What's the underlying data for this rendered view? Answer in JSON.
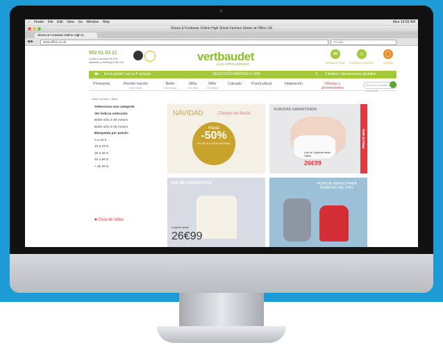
{
  "mac_menubar": {
    "items": [
      "Finder",
      "File",
      "Edit",
      "View",
      "Go",
      "Window",
      "Help"
    ],
    "clock": "Mon 14:55 AM"
  },
  "browser": {
    "window_title": "Shoes & Footwear Online High Street Fashion Shoes at Office UK",
    "tab_label": "Shoes & Footwear Online High S...",
    "url": "www.office.co.uk",
    "search_placeholder": "Google"
  },
  "header": {
    "phone": "902 01 03 21",
    "phone_sub": "Lunes a viernes 9h-22h, sábados y domingos 9h-21h",
    "logo": "vertbaudet",
    "tagline": "¡Los niños primero!",
    "icons": [
      {
        "label": "NEWSLETTER",
        "icon": "mail-icon"
      },
      {
        "label": "ESPACIO CLIENTE",
        "icon": "user-icon"
      },
      {
        "label": "CESTA",
        "icon": "basket-icon"
      }
    ]
  },
  "promo_bar": {
    "left": "Envío gratis* con tu 4º artículo",
    "center": "SELECCIÓN NAVIDAD A -50%",
    "right": "Cambios / devoluciones gratuitas"
  },
  "nav": {
    "items": [
      {
        "label": "Premamá",
        "sub": ""
      },
      {
        "label": "Recién nacido",
        "sub": "0/18 meses"
      },
      {
        "label": "Bebé",
        "sub": "0/36 meses"
      },
      {
        "label": "Niña",
        "sub": "2/14 años"
      },
      {
        "label": "Niño",
        "sub": "2/14 años"
      },
      {
        "label": "Calzado",
        "sub": ""
      },
      {
        "label": "Puericultura",
        "sub": ""
      },
      {
        "label": "Habitación",
        "sub": ""
      },
      {
        "label": "Ofertas y promociones",
        "sub": ""
      }
    ],
    "search_placeholder": "Busca por producto o por número de..."
  },
  "breadcrumb": "Volver al inicio  >  Bebé",
  "sidebar": {
    "items": [
      {
        "label": "Selecciona una categoría",
        "bold": true
      },
      {
        "label": "Ver toda la colección",
        "bold": true
      },
      {
        "label": "Bebé niña 3-36 meses",
        "bold": false
      },
      {
        "label": "Bebé niño 3-36 meses",
        "bold": false
      },
      {
        "label": "Búsqueda por precio:",
        "bold": true
      },
      {
        "label": "0 a 10 €",
        "bold": false
      },
      {
        "label": "10 a 20 €",
        "bold": false
      },
      {
        "label": "20 a 40 €",
        "bold": false
      },
      {
        "label": "40 a 50 €",
        "bold": false
      },
      {
        "label": "+ de 50 €",
        "bold": false
      }
    ],
    "guia": "Guía de tallas"
  },
  "cards": {
    "navidad": {
      "title": "NAVIDAD",
      "subtitle": "¡Tiempo de fiesta!",
      "hasta": "Hasta",
      "percent": "-50%",
      "note": "EN SELECCIÓN NAVIDAD"
    },
    "suavidad": {
      "title": "SUAVIDAD GARANTIZADA",
      "ribbon": "PRECIO MINI",
      "lote": "Lote de 3 pijamas desde 29€99",
      "price": "26€99"
    },
    "conjuntitos": {
      "title": "SUS 1ER CONJUNTITOS",
      "desde": "Conjunto desde",
      "price": "26€99"
    },
    "abrigo": {
      "title": "ROPA DE ABRIGO PARA REMATAR DEL FRÍO"
    }
  }
}
